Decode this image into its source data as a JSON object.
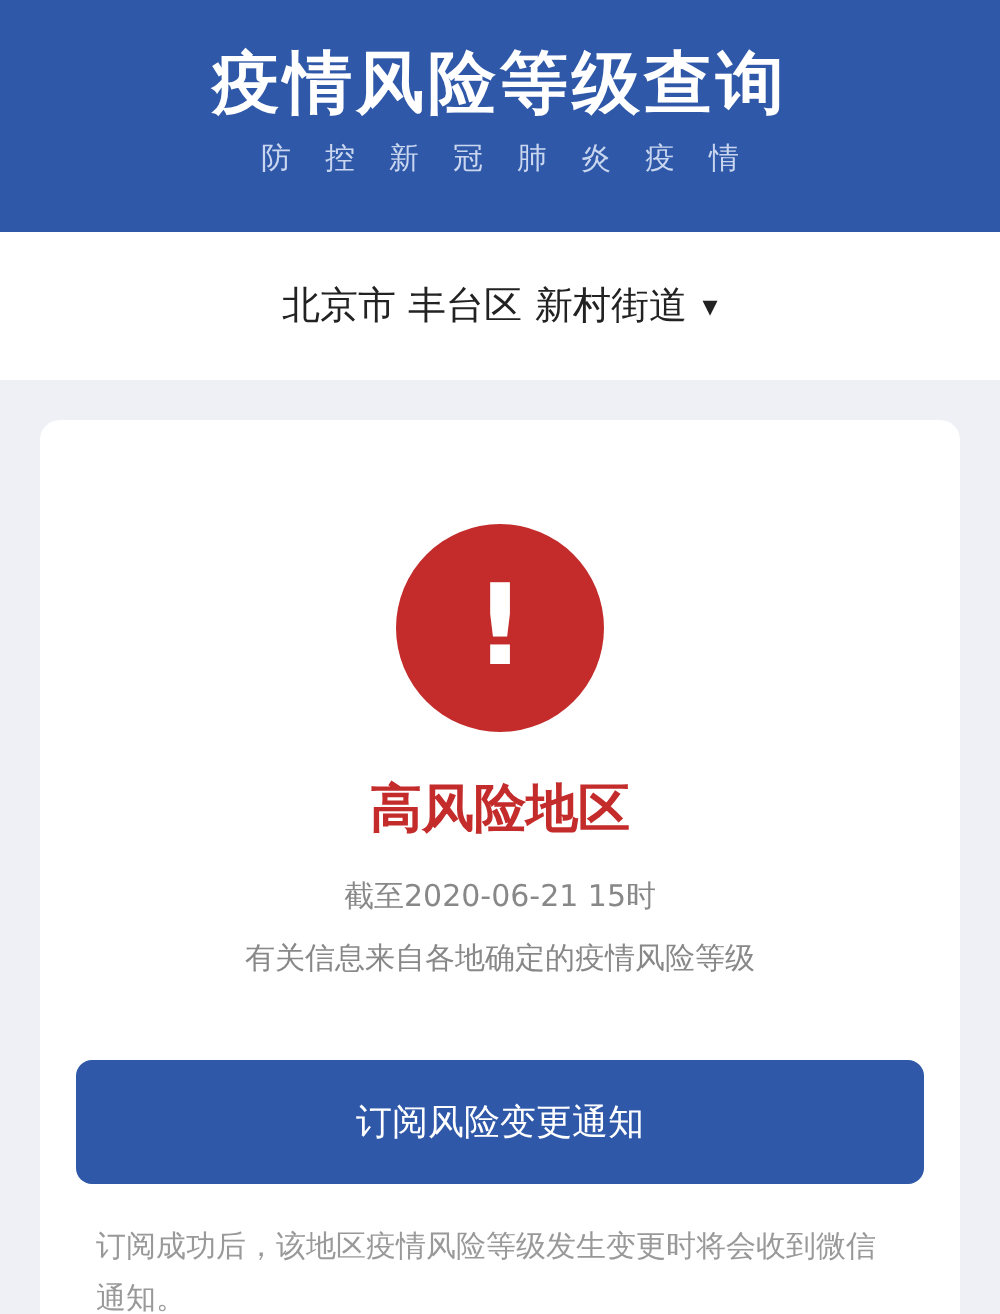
{
  "header": {
    "title": "疫情风险等级查询",
    "subtitle": "防控新冠肺炎疫情"
  },
  "location": {
    "value": "北京市 丰台区 新村街道",
    "caret": "▾"
  },
  "result": {
    "kind": "high",
    "mark": "!",
    "label": "高风险地区",
    "as_of": "截至2020-06-21 15时",
    "source": "有关信息来自各地确定的疫情风险等级"
  },
  "subscribe_button": "订阅风险变更通知",
  "note": "订阅成功后，该地区疫情风险等级发生变更时将会收到微信通知。"
}
